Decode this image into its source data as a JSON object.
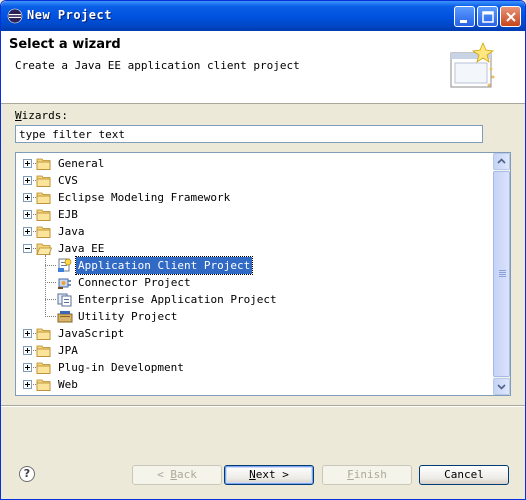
{
  "window": {
    "title": "New Project"
  },
  "banner": {
    "title": "Select a wizard",
    "description": "Create a Java EE application client project"
  },
  "wizards": {
    "label_mnemonic": "W",
    "label_rest": "izards:",
    "filter_value": "type filter text"
  },
  "tree": {
    "items": [
      {
        "label": "General",
        "expanded": false,
        "level": 0,
        "icon": "folder-icon"
      },
      {
        "label": "CVS",
        "expanded": false,
        "level": 0,
        "icon": "folder-icon"
      },
      {
        "label": "Eclipse Modeling Framework",
        "expanded": false,
        "level": 0,
        "icon": "folder-icon"
      },
      {
        "label": "EJB",
        "expanded": false,
        "level": 0,
        "icon": "folder-icon"
      },
      {
        "label": "Java",
        "expanded": false,
        "level": 0,
        "icon": "folder-icon"
      },
      {
        "label": "Java EE",
        "expanded": true,
        "level": 0,
        "icon": "folder-open-icon"
      },
      {
        "label": "Application Client Project",
        "level": 1,
        "icon": "application-client-project-icon",
        "selected": true
      },
      {
        "label": "Connector Project",
        "level": 1,
        "icon": "connector-project-icon"
      },
      {
        "label": "Enterprise Application Project",
        "level": 1,
        "icon": "enterprise-application-project-icon"
      },
      {
        "label": "Utility Project",
        "level": 1,
        "icon": "utility-project-icon"
      },
      {
        "label": "JavaScript",
        "expanded": false,
        "level": 0,
        "icon": "folder-icon"
      },
      {
        "label": "JPA",
        "expanded": false,
        "level": 0,
        "icon": "folder-icon"
      },
      {
        "label": "Plug-in Development",
        "expanded": false,
        "level": 0,
        "icon": "folder-icon"
      },
      {
        "label": "Web",
        "expanded": false,
        "level": 0,
        "icon": "folder-icon"
      }
    ]
  },
  "buttons": {
    "back_prefix": "< ",
    "back_mnemonic": "B",
    "back_rest": "ack",
    "next_mnemonic": "N",
    "next_rest": "ext >",
    "finish_mnemonic": "F",
    "finish_rest": "inish",
    "cancel": "Cancel",
    "help": "?"
  },
  "colors": {
    "title_bar": "#0053e0",
    "selection": "#316ac5",
    "dialog_bg": "#ece9d8"
  }
}
